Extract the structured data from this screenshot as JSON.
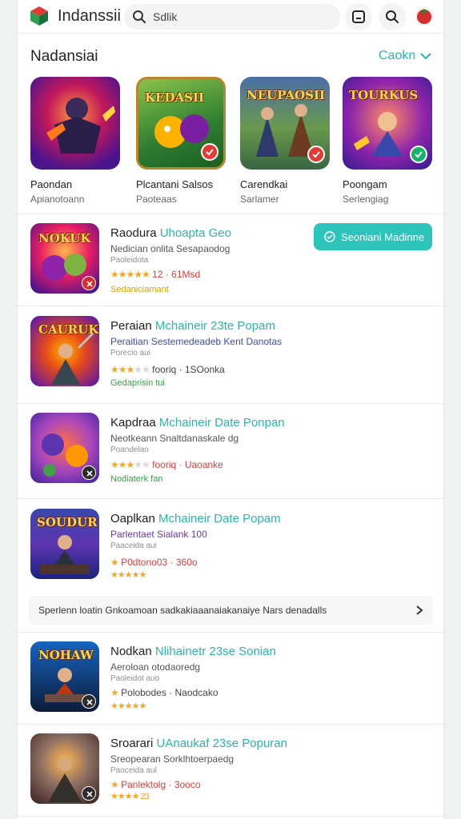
{
  "header": {
    "app_name": "Indanssii",
    "search_value": "Sdlik",
    "icons": [
      "menu-square-icon",
      "search-icon",
      "user-avatar-icon"
    ]
  },
  "section": {
    "title": "Nadansiai",
    "action_label": "Caokn"
  },
  "featured": [
    {
      "name": "Paondan",
      "sub": "Apianotoann",
      "art": "",
      "badge": "none"
    },
    {
      "name": "Plcantani Salsos",
      "sub": "Paoteaas",
      "art": "KEDASII",
      "badge": "red-check"
    },
    {
      "name": "Carendkai",
      "sub": "Sarlamer",
      "art": "NEUPAOSII",
      "badge": "red-check"
    },
    {
      "name": "Poongam",
      "sub": "Serlengiag",
      "art": "TOURKUS",
      "badge": "green-check"
    }
  ],
  "list": [
    {
      "art": "NOKUK",
      "title": "Raodura",
      "title_hl": "Uhoapta Geo",
      "sub": "Nedician onlita Sesapaodog",
      "meta": "Paoleidota",
      "stars": "★★★★★",
      "rating_text": "12 · 61Msd",
      "dev": "Sedaniciamant",
      "dev_color": "#d9a000",
      "cta": "Seoniani Madinne"
    },
    {
      "art": "CAURUK",
      "title": "Peraian",
      "title_hl": "Mchaineir 23te Popam",
      "sub": "Peraitian Sestemedeadeb Kent Danotas",
      "meta": "Porecio aui",
      "stars": "★★★",
      "stars_dim": "★★",
      "rating_text": "fooriq · 1SOonka",
      "dev": "Gedaprisin tui",
      "dev_color": "#3aa14a"
    },
    {
      "art": "",
      "title": "Kapdraa",
      "title_hl": "Mchaineir Date Ponpan",
      "sub": "Neotkeann Snaltdanaskale dg",
      "meta": "Poandelao",
      "stars": "★★★",
      "stars_dim": "★★",
      "rating_text": "fooriq · Uaoanke",
      "dev": "Nodiaterk fan",
      "dev_color": "#3aa14a"
    },
    {
      "art": "SOUDUR",
      "title": "Oaplkan",
      "title_hl": "Mchaineir Date Popam",
      "sub": "Parlentaet Sialank 100",
      "meta": "Paaceida aui",
      "stars": "★",
      "rating_text": "P0dtono03 · 360o",
      "dev": "★★★★★",
      "dev_color": "#f5a623"
    },
    {
      "art": "NOHAW",
      "title": "Nodkan",
      "title_hl": "Nlihainetr 23se Sonian",
      "sub": "Aeroloan otodaoredg",
      "meta": "Paoleidot auo",
      "stars": "★",
      "rating_text": "Polobodes · Naodcako",
      "dev": "★★★★★",
      "dev_color": "#f5a623"
    },
    {
      "art": "",
      "title": "Sroarari",
      "title_hl": "UAnaukaf 23se Popuran",
      "sub": "Sreopearan Sorklhtoerpaedg",
      "meta": "Paoceida aul",
      "stars": "★",
      "rating_text": "Panlektolg · 3ooco",
      "dev": "★★★★ 23",
      "dev_color": "#f5a623"
    }
  ],
  "banner": {
    "text": "Sperlenn loatin Gnkoamoan sadkakiaaanaiakanaiye Nars denadalls"
  },
  "colors": {
    "accent": "#2cc4bb",
    "link": "#25b7b0",
    "star": "#f5a623",
    "danger": "#e53935"
  }
}
